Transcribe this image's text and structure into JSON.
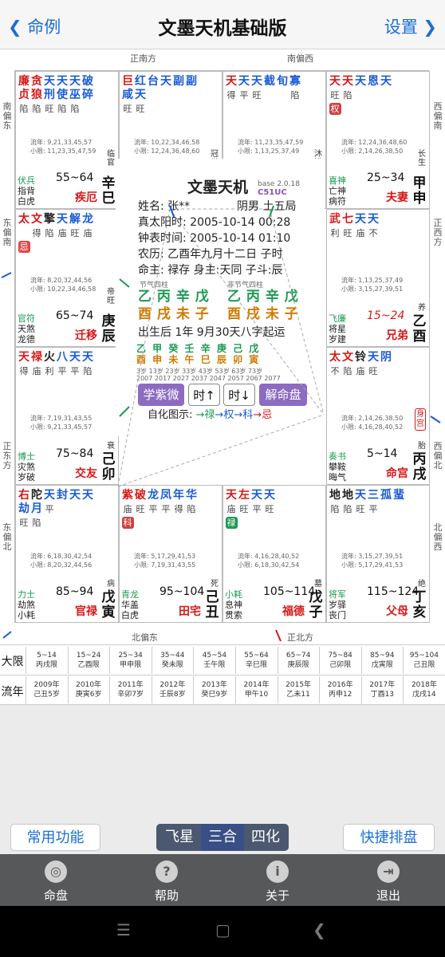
{
  "nav": {
    "back": "命例",
    "title": "文墨天机基础版",
    "settings": "设置"
  },
  "dir": {
    "top_left": "正南方",
    "top_right": "南偏西",
    "bottom_left": "北偏东",
    "bottom_right": "正北方",
    "left_1": "南偏东",
    "left_2": "东偏南",
    "left_3": "正东方",
    "left_4": "东偏北",
    "right_1": "西偏南",
    "right_2": "正西方",
    "right_3": "西偏北",
    "right_4": "北偏西"
  },
  "palaces": [
    {
      "stars": [
        {
          "n": "廉",
          "b": "陷",
          "c": "#d81818"
        },
        {
          "n": "贪",
          "b": "陷",
          "c": "#d81818"
        },
        {
          "n": "天",
          "b": "旺",
          "c": "#1a5bd8"
        },
        {
          "n": "天",
          "b": "陷",
          "c": "#1a5bd8"
        },
        {
          "n": "天",
          "b": "陷",
          "c": "#1a5bd8"
        },
        {
          "n": "破",
          "b": "",
          "c": "#1a5bd8"
        },
        {
          "n": "贞",
          "b": "",
          "c": "#d81818"
        },
        {
          "n": "狼",
          "b": "",
          "c": "#d81818"
        },
        {
          "n": "刑",
          "b": "",
          "c": "#1a5bd8"
        },
        {
          "n": "使",
          "b": "",
          "c": "#1a5bd8"
        },
        {
          "n": "巫",
          "b": "",
          "c": "#1a5bd8"
        },
        {
          "n": "碎",
          "b": "陷",
          "c": "#1a5bd8"
        }
      ],
      "lines": [
        "流年: 9,21,33,45,57",
        "小限: 11,23,35,47,59"
      ],
      "stage": "55~64",
      "gs": "临官",
      "gz": "辛巳",
      "bl": [
        {
          "t": "伏兵",
          "c": "#1a9a50"
        },
        {
          "t": "指背",
          "c": "#222"
        },
        {
          "t": "白虎",
          "c": "#222"
        }
      ],
      "gong": "疾厄",
      "tag": "",
      "hua": ""
    },
    {
      "stars": [
        {
          "n": "巨",
          "b": "旺",
          "c": "#d81818"
        },
        {
          "n": "红",
          "b": "旺",
          "c": "#1a5bd8"
        },
        {
          "n": "台",
          "b": "",
          "c": "#1a5bd8"
        },
        {
          "n": "天",
          "b": "",
          "c": "#1a5bd8"
        },
        {
          "n": "副",
          "b": "",
          "c": "#1a5bd8"
        },
        {
          "n": "副",
          "b": "",
          "c": "#1a5bd8"
        },
        {
          "n": "咸",
          "b": "",
          "c": "#1a5bd8"
        },
        {
          "n": "天",
          "b": "",
          "c": "#1a5bd8"
        }
      ],
      "lines": [
        "流年: 10,22,34,46,58",
        "小限: 12,24,36,48,60"
      ],
      "stage": "45~54",
      "gs": "冠带",
      "gz": "壬午",
      "bl": [
        {
          "t": "大耗",
          "c": "#1a9a50"
        },
        {
          "t": "咸池",
          "c": "#222"
        },
        {
          "t": "天德",
          "c": "#222"
        }
      ],
      "gong": "财帛",
      "tag": "",
      "hua": ""
    },
    {
      "stars": [
        {
          "n": "天",
          "b": "得",
          "c": "#d81818"
        },
        {
          "n": "天",
          "b": "平",
          "c": "#1a5bd8"
        },
        {
          "n": "天",
          "b": "旺",
          "c": "#1a5bd8"
        },
        {
          "n": "截",
          "b": "",
          "c": "#1a5bd8"
        },
        {
          "n": "旬",
          "b": "",
          "c": "#1a5bd8"
        },
        {
          "n": "寡",
          "b": "陷",
          "c": "#1a5bd8"
        }
      ],
      "lines": [
        "流年: 11,23,35,47,59",
        "小限: 1,13,25,37,49"
      ],
      "stage": "35~44",
      "gs": "沐浴",
      "gz": "癸未",
      "bl": [
        {
          "t": "病符",
          "c": "#1a9a50"
        },
        {
          "t": "月煞",
          "c": "#222"
        },
        {
          "t": "吊客",
          "c": "#222"
        }
      ],
      "gong": "子女",
      "tag": "",
      "hua": ""
    },
    {
      "stars": [
        {
          "n": "天",
          "b": "旺",
          "c": "#d81818"
        },
        {
          "n": "天",
          "b": "陷",
          "c": "#d81818"
        },
        {
          "n": "天",
          "b": "",
          "c": "#1a5bd8"
        },
        {
          "n": "恩",
          "b": "",
          "c": "#1a5bd8"
        },
        {
          "n": "天",
          "b": "",
          "c": "#1a5bd8"
        }
      ],
      "lines": [
        "流年: 12,24,36,48,60",
        "小限: 2,14,26,38,50"
      ],
      "stage": "25~34",
      "gs": "长生",
      "gz": "甲申",
      "bl": [
        {
          "t": "喜神",
          "c": "#1a9a50"
        },
        {
          "t": "亡神",
          "c": "#222"
        },
        {
          "t": "病符",
          "c": "#222"
        }
      ],
      "gong": "夫妻",
      "tag": "",
      "hua": "权"
    },
    {
      "stars": [
        {
          "n": "太",
          "b": "",
          "c": "#d81818"
        },
        {
          "n": "文",
          "b": "得",
          "c": "#d81818"
        },
        {
          "n": "擎",
          "b": "陷",
          "c": "#222"
        },
        {
          "n": "天",
          "b": "庙",
          "c": "#1a5bd8"
        },
        {
          "n": "解",
          "b": "旺",
          "c": "#1a5bd8"
        },
        {
          "n": "龙",
          "b": "庙",
          "c": "#1a5bd8"
        }
      ],
      "lines": [
        "流年: 8,20,32,44,56",
        "小限: 10,22,34,46,58"
      ],
      "stage": "65~74",
      "gs": "帝旺",
      "gz": "庚辰",
      "bl": [
        {
          "t": "官符",
          "c": "#1a9a50"
        },
        {
          "t": "天煞",
          "c": "#222"
        },
        {
          "t": "龙德",
          "c": "#222"
        }
      ],
      "gong": "迁移",
      "tag": "",
      "hua": "忌"
    },
    {
      "stars": [
        {
          "n": "武",
          "b": "利",
          "c": "#d81818"
        },
        {
          "n": "七",
          "b": "旺",
          "c": "#d81818"
        },
        {
          "n": "天",
          "b": "庙",
          "c": "#1a5bd8"
        },
        {
          "n": "天",
          "b": "不",
          "c": "#1a5bd8"
        }
      ],
      "lines": [
        "流年: 1,13,25,37,49",
        "小限: 3,15,27,39,51"
      ],
      "stage": "15~24",
      "gs": "养",
      "gz": "乙酉",
      "bl": [
        {
          "t": "飞廉",
          "c": "#1a9a50"
        },
        {
          "t": "将星",
          "c": "#222"
        },
        {
          "t": "岁建",
          "c": "#222"
        }
      ],
      "gong": "兄弟",
      "tag": "",
      "hua": ""
    },
    {
      "stars": [
        {
          "n": "天",
          "b": "得",
          "c": "#d81818"
        },
        {
          "n": "禄",
          "b": "庙",
          "c": "#d81818"
        },
        {
          "n": "火",
          "b": "利",
          "c": "#222"
        },
        {
          "n": "八",
          "b": "平",
          "c": "#1a5bd8"
        },
        {
          "n": "天",
          "b": "平",
          "c": "#1a5bd8"
        },
        {
          "n": "天",
          "b": "陷",
          "c": "#1a5bd8"
        }
      ],
      "lines": [
        "流年: 7,19,31,43,55",
        "小限: 9,21,33,45,57"
      ],
      "stage": "75~84",
      "gs": "衰",
      "gz": "己卯",
      "bl": [
        {
          "t": "博士",
          "c": "#1a9a50"
        },
        {
          "t": "灾煞",
          "c": "#222"
        },
        {
          "t": "岁破",
          "c": "#222"
        }
      ],
      "gong": "交友",
      "tag": "",
      "hua": ""
    },
    {
      "stars": [
        {
          "n": "太",
          "b": "不",
          "c": "#d81818"
        },
        {
          "n": "文",
          "b": "陷",
          "c": "#d81818"
        },
        {
          "n": "铃",
          "b": "庙",
          "c": "#222"
        },
        {
          "n": "天",
          "b": "旺",
          "c": "#1a5bd8"
        },
        {
          "n": "阴",
          "b": "",
          "c": "#1a5bd8"
        }
      ],
      "lines": [
        "流年: 2,14,26,38,50",
        "小限: 4,16,28,40,52"
      ],
      "stage": "5~14",
      "gs": "胎",
      "gz": "丙戌",
      "bl": [
        {
          "t": "奏书",
          "c": "#1a9a50"
        },
        {
          "t": "攀鞍",
          "c": "#222"
        },
        {
          "t": "晦气",
          "c": "#222"
        }
      ],
      "gong": "命宫",
      "tag": "身宫",
      "hua": ""
    },
    {
      "stars": [
        {
          "n": "右",
          "b": "旺",
          "c": "#d81818"
        },
        {
          "n": "陀",
          "b": "陷",
          "c": "#222"
        },
        {
          "n": "天",
          "b": "平",
          "c": "#1a5bd8"
        },
        {
          "n": "封",
          "b": "",
          "c": "#1a5bd8"
        },
        {
          "n": "天",
          "b": "",
          "c": "#1a5bd8"
        },
        {
          "n": "天",
          "b": "",
          "c": "#1a5bd8"
        },
        {
          "n": "劫",
          "b": "",
          "c": "#1a5bd8"
        },
        {
          "n": "月",
          "b": "",
          "c": "#1a5bd8"
        }
      ],
      "lines": [
        "流年: 6,18,30,42,54",
        "小限: 8,20,32,44,56"
      ],
      "stage": "85~94",
      "gs": "病",
      "gz": "戊寅",
      "bl": [
        {
          "t": "力士",
          "c": "#1a9a50"
        },
        {
          "t": "劫煞",
          "c": "#222"
        },
        {
          "t": "小耗",
          "c": "#222"
        }
      ],
      "gong": "官禄",
      "tag": "",
      "hua": ""
    },
    {
      "stars": [
        {
          "n": "紫",
          "b": "庙",
          "c": "#d81818"
        },
        {
          "n": "破",
          "b": "旺",
          "c": "#d81818"
        },
        {
          "n": "龙",
          "b": "平",
          "c": "#1a5bd8"
        },
        {
          "n": "凤",
          "b": "平",
          "c": "#1a5bd8"
        },
        {
          "n": "年",
          "b": "得",
          "c": "#1a5bd8"
        },
        {
          "n": "华",
          "b": "陷",
          "c": "#1a5bd8"
        }
      ],
      "lines": [
        "流年: 5,17,29,41,53",
        "小限: 7,19,31,43,55"
      ],
      "stage": "95~104",
      "gs": "死",
      "gz": "己丑",
      "bl": [
        {
          "t": "青龙",
          "c": "#1a9a50"
        },
        {
          "t": "华盖",
          "c": "#222"
        },
        {
          "t": "白虎",
          "c": "#222"
        }
      ],
      "gong": "田宅",
      "tag": "",
      "hua": "科"
    },
    {
      "stars": [
        {
          "n": "天",
          "b": "庙",
          "c": "#d81818"
        },
        {
          "n": "左",
          "b": "旺",
          "c": "#d81818"
        },
        {
          "n": "天",
          "b": "平",
          "c": "#1a5bd8"
        },
        {
          "n": "天",
          "b": "旺",
          "c": "#1a5bd8"
        }
      ],
      "lines": [
        "流年: 4,16,28,40,52",
        "小限: 6,18,30,42,54"
      ],
      "stage": "105~114",
      "gs": "墓",
      "gz": "戊子",
      "bl": [
        {
          "t": "小耗",
          "c": "#1a9a50"
        },
        {
          "t": "息神",
          "c": "#222"
        },
        {
          "t": "贯索",
          "c": "#222"
        }
      ],
      "gong": "福德",
      "tag": "",
      "hua": "禄"
    },
    {
      "stars": [
        {
          "n": "地",
          "b": "陷",
          "c": "#222"
        },
        {
          "n": "地",
          "b": "陷",
          "c": "#222"
        },
        {
          "n": "天",
          "b": "旺",
          "c": "#1a5bd8"
        },
        {
          "n": "三",
          "b": "平",
          "c": "#1a5bd8"
        },
        {
          "n": "孤",
          "b": "",
          "c": "#1a5bd8"
        },
        {
          "n": "蜚",
          "b": "",
          "c": "#1a5bd8"
        }
      ],
      "lines": [
        "流年: 3,15,27,39,51",
        "小限: 5,17,29,41,53"
      ],
      "stage": "115~124",
      "gs": "绝",
      "gz": "丁亥",
      "bl": [
        {
          "t": "将军",
          "c": "#1a9a50"
        },
        {
          "t": "岁驿",
          "c": "#222"
        },
        {
          "t": "丧门",
          "c": "#222"
        }
      ],
      "gong": "父母",
      "tag": "",
      "hua": ""
    }
  ],
  "center": {
    "app": "文墨天机",
    "ver": "base 2.0.18",
    "code": "C51UC",
    "name": "姓名: 张**",
    "gender": "阴男 土五局",
    "true_sun": "真太阳时: 2005-10-14 00:28",
    "clock": "钟表时间: 2005-10-14 01:10",
    "lunar": "农历: 乙酉年九月十二日 子时",
    "ming": "命主: 禄存 身主:天同 子斗:辰",
    "jieqi_label": "节气四柱",
    "jieqi_top": "乙 丙 辛 戊",
    "jieqi_bot": "酉 戌 未 子",
    "fei_label": "非节气四柱",
    "fei_top": "乙 丙 辛 戊",
    "fei_bot": "酉 戌 未 子",
    "qiyun": "出生后 1年 9月30天八字起运",
    "dayun_gz": "乙 甲 癸 壬 辛 庚 己 戊",
    "dayun_zhi": "酉 申 未 午 巳 辰 卯 寅",
    "dayun_age": "3岁 13岁 23岁 33岁 43岁 53岁 63岁 73岁",
    "dayun_year": "2007 2017 2027 2037 2047 2057 2067 2077",
    "btn_xue": "学紫微",
    "btn_up": "时↑",
    "btn_down": "时↓",
    "btn_jie": "解命盘",
    "legend": "自化图示: →禄→权→科→忌"
  },
  "table": {
    "dx_label": "大限",
    "ln_label": "流年",
    "dx": [
      [
        "5~14",
        "丙戌限"
      ],
      [
        "15~24",
        "乙酉限"
      ],
      [
        "25~34",
        "甲申限"
      ],
      [
        "35~44",
        "癸未限"
      ],
      [
        "45~54",
        "壬午限"
      ],
      [
        "55~64",
        "辛巳限"
      ],
      [
        "65~74",
        "庚辰限"
      ],
      [
        "75~84",
        "己卯限"
      ],
      [
        "85~94",
        "戊寅限"
      ],
      [
        "95~104",
        "己丑限"
      ]
    ],
    "ln": [
      [
        "2009年",
        "己丑5岁"
      ],
      [
        "2010年",
        "庚寅6岁"
      ],
      [
        "2011年",
        "辛卯7岁"
      ],
      [
        "2012年",
        "壬辰8岁"
      ],
      [
        "2013年",
        "癸巳9岁"
      ],
      [
        "2014年",
        "甲午10"
      ],
      [
        "2015年",
        "乙未11"
      ],
      [
        "2016年",
        "丙申12"
      ],
      [
        "2017年",
        "丁酉13"
      ],
      [
        "2018年",
        "戊戌14"
      ]
    ]
  },
  "buttons": {
    "left": "常用功能",
    "right": "快捷排盘",
    "seg": [
      "飞星",
      "三合",
      "四化"
    ]
  },
  "tabs": [
    {
      "label": "命盘",
      "icon": "◎"
    },
    {
      "label": "帮助",
      "icon": "?"
    },
    {
      "label": "关于",
      "icon": "i"
    },
    {
      "label": "退出",
      "icon": "⇥"
    }
  ]
}
